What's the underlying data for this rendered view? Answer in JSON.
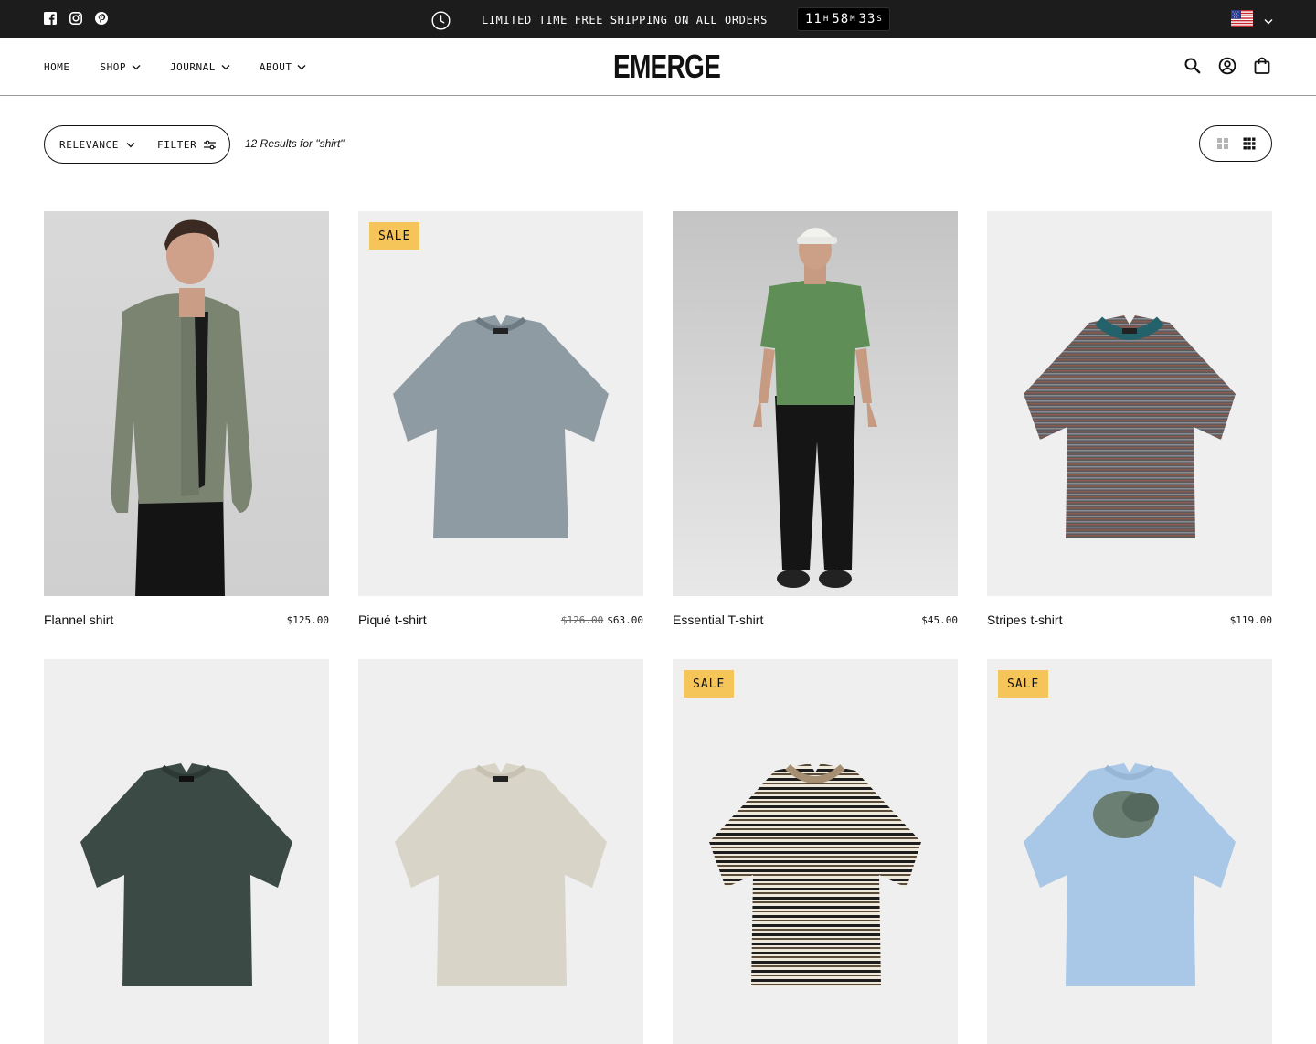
{
  "announcement": {
    "text": "LIMITED TIME FREE SHIPPING ON ALL ORDERS",
    "countdown": {
      "hours": "11",
      "hours_unit": "H",
      "minutes": "58",
      "minutes_unit": "M",
      "seconds": "33",
      "seconds_unit": "S"
    },
    "social_icons": [
      "facebook-icon",
      "instagram-icon",
      "pinterest-icon"
    ],
    "locale_flag": "us-flag-icon"
  },
  "header": {
    "logo": "EMERGE",
    "nav": [
      {
        "label": "HOME",
        "dropdown": false
      },
      {
        "label": "SHOP",
        "dropdown": true
      },
      {
        "label": "JOURNAL",
        "dropdown": true
      },
      {
        "label": "ABOUT",
        "dropdown": true
      }
    ],
    "icons": [
      "search-icon",
      "account-icon",
      "cart-icon"
    ]
  },
  "toolbar": {
    "sort_label": "RELEVANCE",
    "filter_label": "FILTER",
    "results_text": "12 Results for \"shirt\""
  },
  "products": [
    {
      "name": "Flannel shirt",
      "price": "$125.00",
      "old_price": "",
      "badge": ""
    },
    {
      "name": "Piqué t-shirt",
      "price": "$63.00",
      "old_price": "$126.00",
      "badge": "SALE"
    },
    {
      "name": "Essential T-shirt",
      "price": "$45.00",
      "old_price": "",
      "badge": ""
    },
    {
      "name": "Stripes t-shirt",
      "price": "$119.00",
      "old_price": "",
      "badge": ""
    },
    {
      "name": "",
      "price": "",
      "old_price": "",
      "badge": ""
    },
    {
      "name": "",
      "price": "",
      "old_price": "",
      "badge": ""
    },
    {
      "name": "",
      "price": "",
      "old_price": "",
      "badge": "SALE"
    },
    {
      "name": "",
      "price": "",
      "old_price": "",
      "badge": "SALE"
    }
  ],
  "colors": {
    "announcement_bg": "#1c1c1c",
    "sale_badge": "#f6c55a",
    "image_bg": "#efefef"
  }
}
